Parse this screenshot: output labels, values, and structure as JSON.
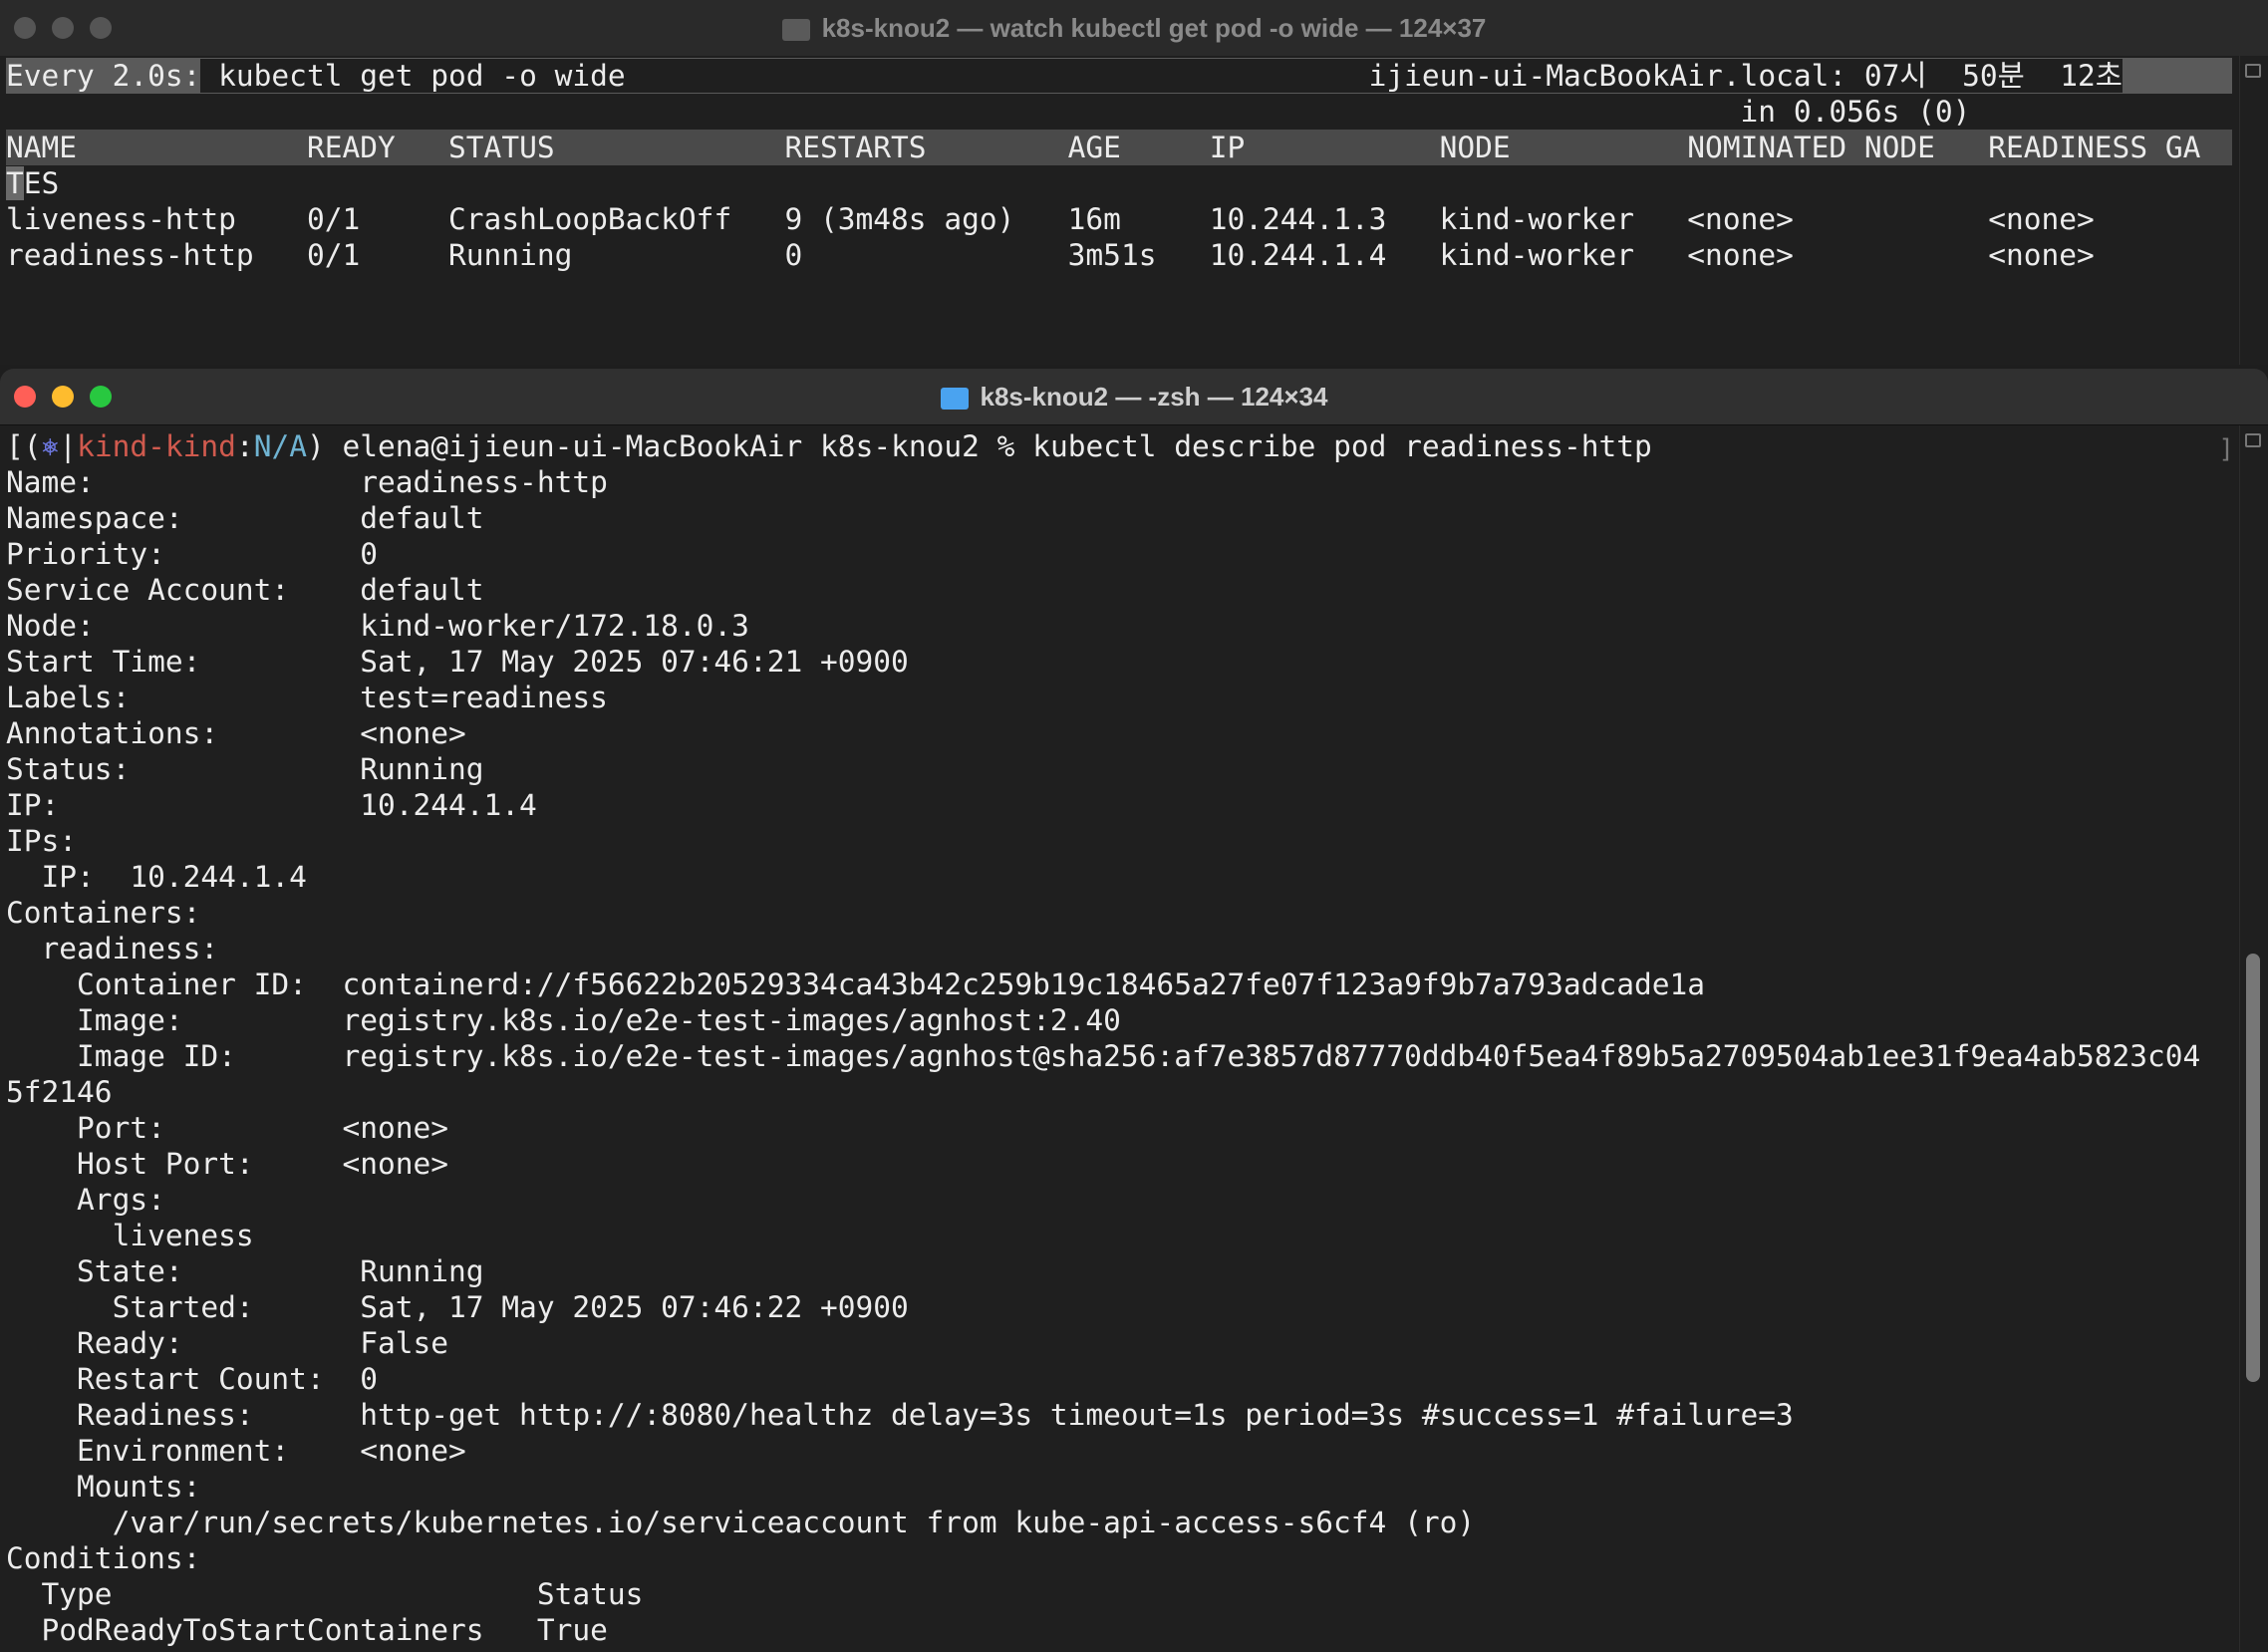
{
  "top_window": {
    "title": "k8s-knou2 — watch kubectl get pod -o wide — 124×37",
    "watch_prefix": "Every 2.0s:",
    "command": "kubectl get pod -o wide",
    "host_time": "ijieun-ui-MacBookAir.local: 07시  50분  12초",
    "elapsed": "in 0.056s (0)",
    "table": {
      "header": [
        "NAME",
        "READY",
        "STATUS",
        "RESTARTS",
        "AGE",
        "IP",
        "NODE",
        "NOMINATED NODE",
        "READINESS GA"
      ],
      "header_wrap": "TES",
      "rows": [
        [
          "liveness-http",
          "0/1",
          "CrashLoopBackOff",
          "9 (3m48s ago)",
          "16m",
          "10.244.1.3",
          "kind-worker",
          "<none>",
          "<none>"
        ],
        [
          "readiness-http",
          "0/1",
          "Running",
          "0",
          "3m51s",
          "10.244.1.4",
          "kind-worker",
          "<none>",
          "<none>"
        ]
      ]
    }
  },
  "bottom_window": {
    "title": "k8s-knou2 — -zsh — 124×34",
    "prompt": {
      "open": "[(",
      "symbol": "⎈",
      "sep": "|",
      "context": "kind-kind",
      "colon": ":",
      "namespace": "N/A",
      "close": ")",
      "user_host_dir": "elena@ijieun-ui-MacBookAir k8s-knou2 %",
      "command": "kubectl describe pod readiness-http"
    },
    "output_lines": [
      "Name:               readiness-http",
      "Namespace:          default",
      "Priority:           0",
      "Service Account:    default",
      "Node:               kind-worker/172.18.0.3",
      "Start Time:         Sat, 17 May 2025 07:46:21 +0900",
      "Labels:             test=readiness",
      "Annotations:        <none>",
      "Status:             Running",
      "IP:                 10.244.1.4",
      "IPs:",
      "  IP:  10.244.1.4",
      "Containers:",
      "  readiness:",
      "    Container ID:  containerd://f56622b20529334ca43b42c259b19c18465a27fe07f123a9f9b7a793adcade1a",
      "    Image:         registry.k8s.io/e2e-test-images/agnhost:2.40",
      "    Image ID:      registry.k8s.io/e2e-test-images/agnhost@sha256:af7e3857d87770ddb40f5ea4f89b5a2709504ab1ee31f9ea4ab5823c04",
      "5f2146",
      "    Port:          <none>",
      "    Host Port:     <none>",
      "    Args:",
      "      liveness",
      "    State:          Running",
      "      Started:      Sat, 17 May 2025 07:46:22 +0900",
      "    Ready:          False",
      "    Restart Count:  0",
      "    Readiness:      http-get http://:8080/healthz delay=3s timeout=1s period=3s #success=1 #failure=3",
      "    Environment:    <none>",
      "    Mounts:",
      "      /var/run/secrets/kubernetes.io/serviceaccount from kube-api-access-s6cf4 (ro)",
      "Conditions:",
      "  Type                        Status",
      "  PodReadyToStartContainers   True"
    ],
    "corner_mark": "]"
  }
}
